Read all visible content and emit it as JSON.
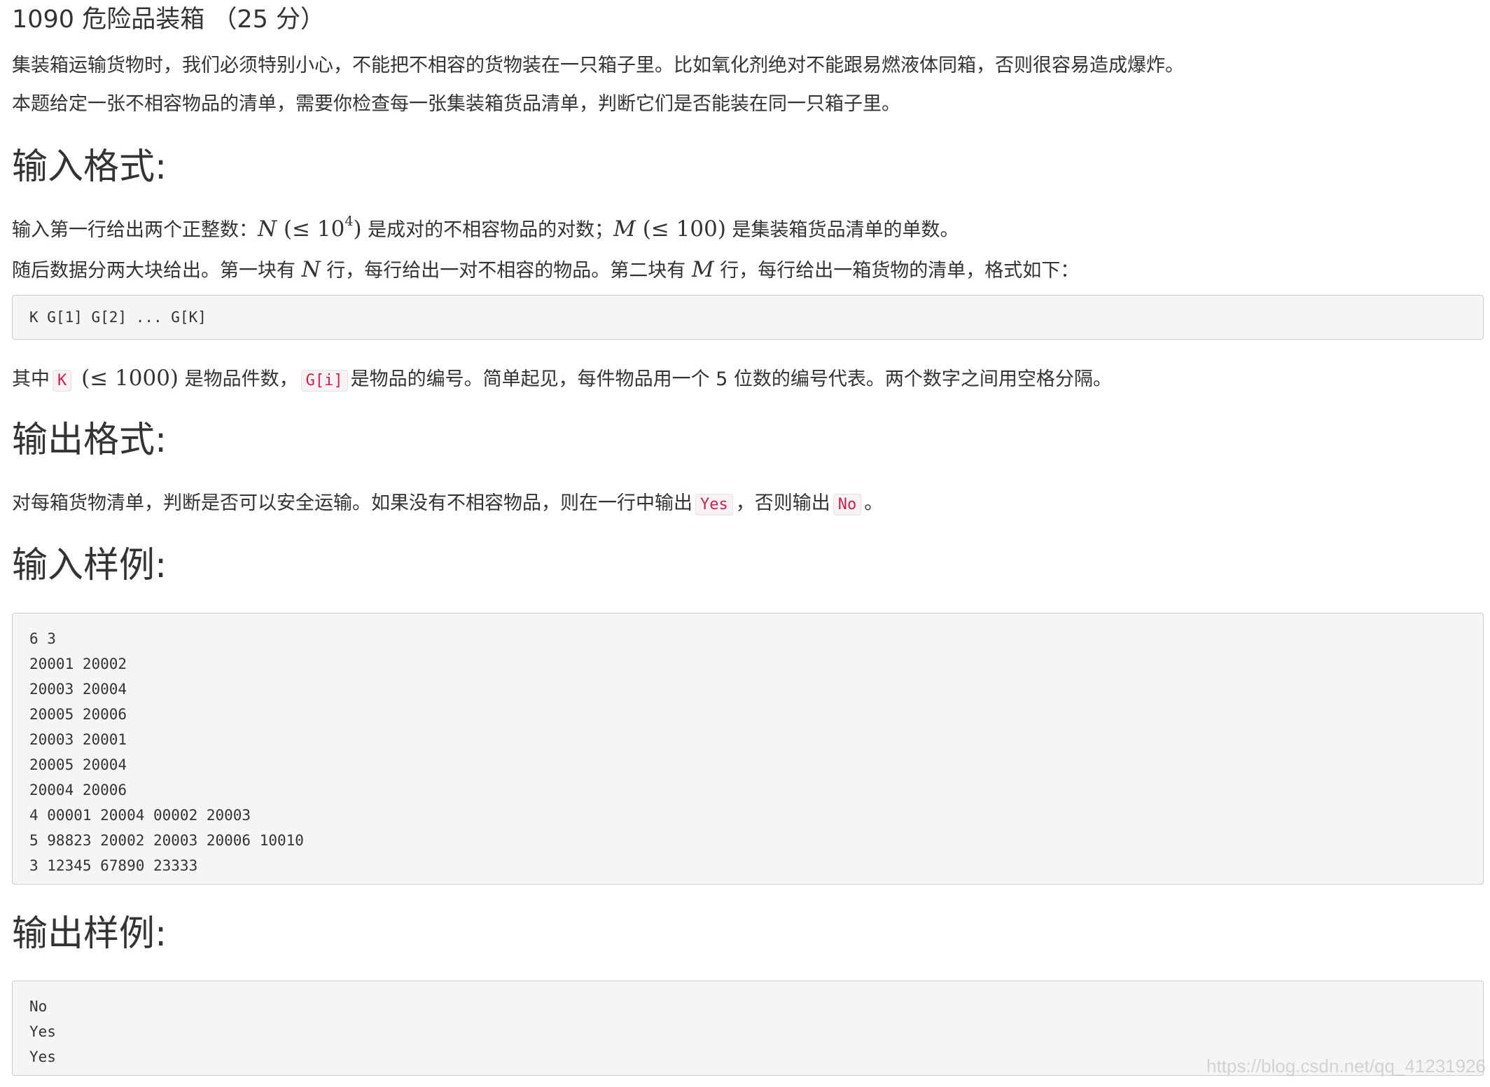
{
  "title": "1090 危险品装箱 （25 分）",
  "intro": {
    "p1": "集装箱运输货物时，我们必须特别小心，不能把不相容的货物装在一只箱子里。比如氧化剂绝对不能跟易燃液体同箱，否则很容易造成爆炸。",
    "p2": "本题给定一张不相容物品的清单，需要你检查每一张集装箱货品清单，判断它们是否能装在同一只箱子里。"
  },
  "input_format": {
    "heading": "输入格式:",
    "line1": {
      "t1": "输入第一行给出两个正整数：",
      "N": "N",
      "c1a": " (≤ 10",
      "c1sup": "4",
      "c1b": ")",
      "t2": " 是成对的不相容物品的对数；",
      "M": "M",
      "c2": " (≤ 100)",
      "t3": " 是集装箱货品清单的单数。"
    },
    "line2": {
      "t1": "随后数据分两大块给出。第一块有 ",
      "N": "N",
      "t2": " 行，每行给出一对不相容的物品。第二块有 ",
      "M": "M",
      "t3": " 行，每行给出一箱货物的清单，格式如下："
    },
    "code": "K G[1] G[2] ... G[K]",
    "line3": {
      "t1": "其中",
      "k": "K",
      "c1": " (≤ 1000)",
      "t2": " 是物品件数，",
      "gi": "G[i]",
      "t3": "是物品的编号。简单起见，每件物品用一个 5 位数的编号代表。两个数字之间用空格分隔。"
    }
  },
  "output_format": {
    "heading": "输出格式:",
    "line": {
      "t1": "对每箱货物清单，判断是否可以安全运输。如果没有不相容物品，则在一行中输出",
      "yes": "Yes",
      "t2": "，否则输出",
      "no": "No",
      "t3": "。"
    }
  },
  "sample_input": {
    "heading": "输入样例:",
    "lines": [
      "6 3",
      "20001 20002",
      "20003 20004",
      "20005 20006",
      "20003 20001",
      "20005 20004",
      "20004 20006",
      "4 00001 20004 00002 20003",
      "5 98823 20002 20003 20006 10010",
      "3 12345 67890 23333"
    ]
  },
  "sample_output": {
    "heading": "输出样例:",
    "lines": [
      "No",
      "Yes",
      "Yes"
    ]
  },
  "watermark": "https://blog.csdn.net/qq_41231926"
}
